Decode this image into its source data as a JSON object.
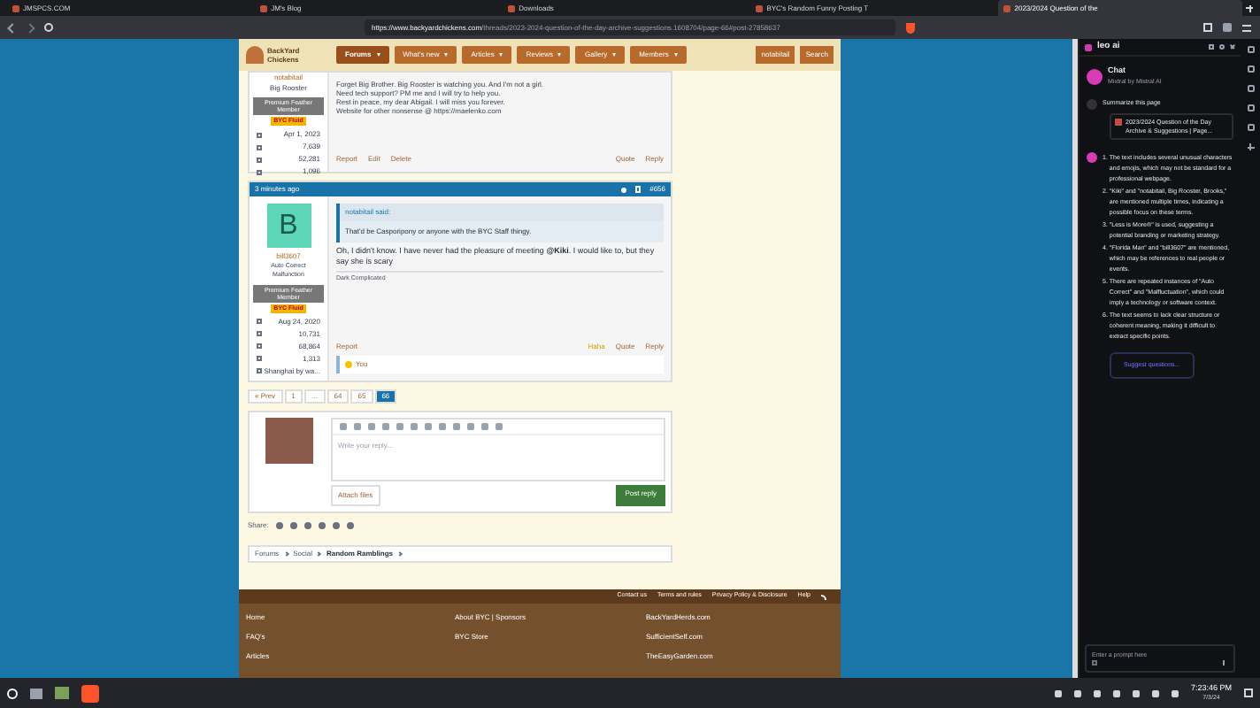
{
  "browser": {
    "tabs": [
      {
        "label": "JMSPCS.COM",
        "selected": false
      },
      {
        "label": "JM's Blog",
        "selected": false
      },
      {
        "label": "Downloads",
        "selected": false
      },
      {
        "label": "BYC's Random Funny Posting T",
        "selected": false
      },
      {
        "label": "2023/2024 Question of the",
        "selected": true
      }
    ],
    "url_host": "https://www.backyardchickens.com",
    "url_path": "/threads/2023-2024-question-of-the-day-archive-suggestions.1608704/page-66#post-27858637"
  },
  "site": {
    "logo": "BackYard Chickens",
    "nav": [
      {
        "label": "Forums",
        "selected": true
      },
      {
        "label": "What's new",
        "selected": false
      },
      {
        "label": "Articles",
        "selected": false
      },
      {
        "label": "Reviews",
        "selected": false
      },
      {
        "label": "Gallery",
        "selected": false
      },
      {
        "label": "Members",
        "selected": false
      }
    ],
    "user": "notabitail",
    "search": "Search"
  },
  "post1": {
    "username": "notabitail",
    "title": "Big Rooster",
    "banner": "Premium Feather Member",
    "flag": "BYC Fluid",
    "stats": [
      "Apr 1, 2023",
      "7,639",
      "52,281",
      "1,096"
    ],
    "signature": [
      "Forget Big Brother. Big Rooster is watching you. And I'm not a girl.",
      "Need tech support? PM me and I will try to help you.",
      "Rest in peace, my dear Abigail. I will miss you forever.",
      "Website for other nonsense @ https://maelenko.com"
    ],
    "actions_left": [
      "Report",
      "Edit",
      "Delete"
    ],
    "actions_right": [
      "Quote",
      "Reply"
    ]
  },
  "post2": {
    "time": "3 minutes ago",
    "number": "#656",
    "avatar_letter": "B",
    "username": "bill3607",
    "title_lines": [
      "Auto Correct",
      "Malfunction"
    ],
    "banner": "Premium Feather Member",
    "flag": "BYC Fluid",
    "stats": [
      "Aug 24, 2020",
      "10,731",
      "68,864",
      "1,313",
      "Shanghai by wa..."
    ],
    "quote_author": "notabitail said:",
    "quote_text": "That'd be Casporipony or anyone with the BYC Staff thingy.",
    "body": "Oh, I didn't know. I have never had the pleasure of meeting **@Kiki**. I would like to, but they say she is scary",
    "signature": "Dark Complicated",
    "report": "Report",
    "reaction": "Haha",
    "quote": "Quote",
    "reply": "Reply",
    "reacted_by": "You"
  },
  "pagination": [
    {
      "label": "« Prev",
      "selected": false
    },
    {
      "label": "1",
      "selected": false
    },
    {
      "label": "…",
      "selected": false
    },
    {
      "label": "64",
      "selected": false
    },
    {
      "label": "65",
      "selected": false
    },
    {
      "label": "66",
      "selected": true
    }
  ],
  "reply": {
    "placeholder": "Write your reply...",
    "attach": "Attach files",
    "post": "Post reply"
  },
  "share": {
    "label": "Share:"
  },
  "breadcrumb": [
    "Forums",
    "Social",
    "Random Ramblings"
  ],
  "footer": {
    "links": [
      "Contact us",
      "Terms and rules",
      "Privacy Policy & Disclosure",
      "Help"
    ],
    "columns": [
      [
        "Home",
        "FAQ's",
        "Articles"
      ],
      [
        "About BYC | Sponsors",
        "BYC Store"
      ],
      [
        "BackYardHerds.com",
        "SufficientSelf.com",
        "TheEasyGarden.com"
      ]
    ]
  },
  "assistant": {
    "title": "leo ai",
    "chat": "Chat",
    "model": "Mixtral by Mistral AI",
    "request": "Summarize this page",
    "page_card": "2023/2024 Question of the Day Archive & Suggestions | Page...",
    "points": [
      {
        "number": "1.",
        "text": "The text includes several unusual characters and emojis, which may not be standard for a professional webpage."
      },
      {
        "number": "2.",
        "text": "\"Kiki\" and \"notabitail, Big Rooster, Brooks,\" are mentioned multiple times, indicating a possible focus on these terms."
      },
      {
        "number": "3.",
        "text": "\"Less is More®\" is used, suggesting a potential branding or marketing strategy."
      },
      {
        "number": "4.",
        "text": "\"Florida Man\" and \"bill3607\" are mentioned, which may be references to real people or events."
      },
      {
        "number": "5.",
        "text": "There are repeated instances of \"Auto Correct\" and \"Malfluctuation\", which could imply a technology or software context."
      },
      {
        "number": "6.",
        "text": "The text seems to lack clear structure or coherent meaning, making it difficult to extract specific points."
      }
    ],
    "suggest": "Suggest questions...",
    "prompt_placeholder": "Enter a prompt here"
  },
  "taskbar": {
    "time": "7:23:46 PM",
    "date": "7/3/24"
  }
}
